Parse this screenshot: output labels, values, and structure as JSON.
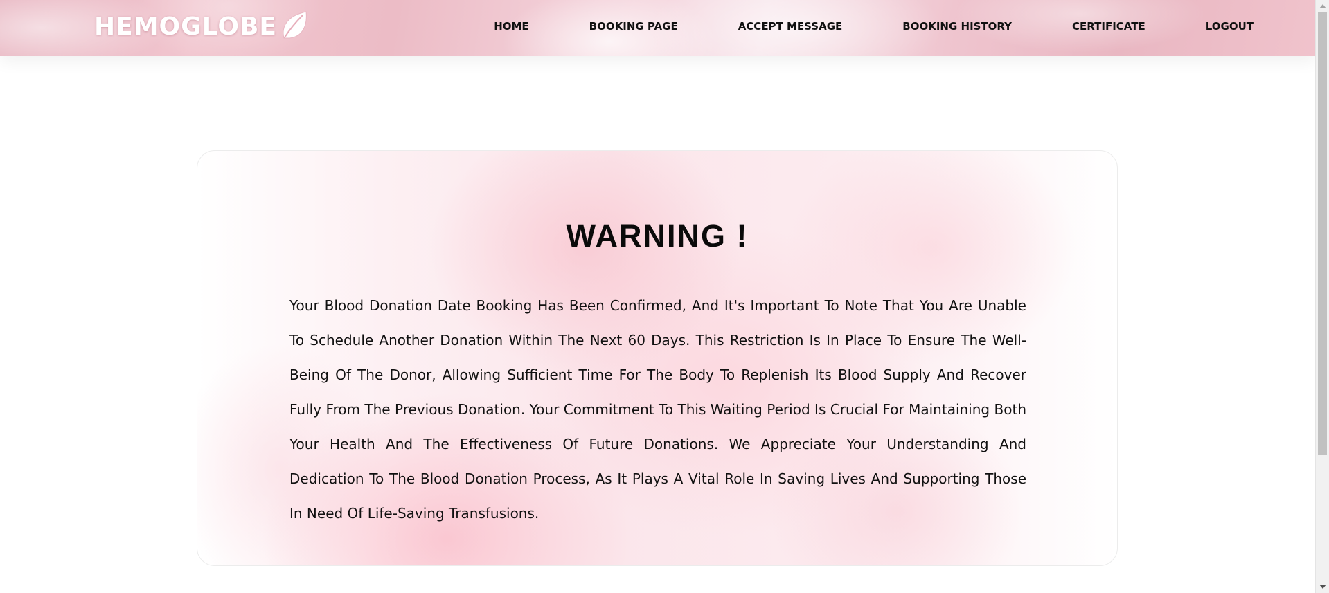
{
  "brand": {
    "name": "HEMOGLOBE",
    "icon": "leaf-icon"
  },
  "nav": {
    "items": [
      {
        "label": "HOME"
      },
      {
        "label": "BOOKING PAGE"
      },
      {
        "label": "ACCEPT MESSAGE"
      },
      {
        "label": "BOOKING HISTORY"
      },
      {
        "label": "CERTIFICATE"
      },
      {
        "label": "LOGOUT"
      }
    ]
  },
  "warning": {
    "title": "WARNING !",
    "message": "Your Blood Donation Date Booking Has Been Confirmed, And It's Important To Note That You Are Unable To Schedule Another Donation Within The Next 60 Days. This Restriction Is In Place To Ensure The Well-Being Of The Donor, Allowing Sufficient Time For The Body To Replenish Its Blood Supply And Recover Fully From The Previous Donation. Your Commitment To This Waiting Period Is Crucial For Maintaining Both Your Health And The Effectiveness Of Future Donations. We Appreciate Your Understanding And Dedication To The Blood Donation Process, As It Plays A Vital Role In Saving Lives And Supporting Those In Need Of Life-Saving Transfusions."
  },
  "colors": {
    "header_pink": "#efc5cf",
    "text": "#111111",
    "card_border": "#ececec"
  }
}
